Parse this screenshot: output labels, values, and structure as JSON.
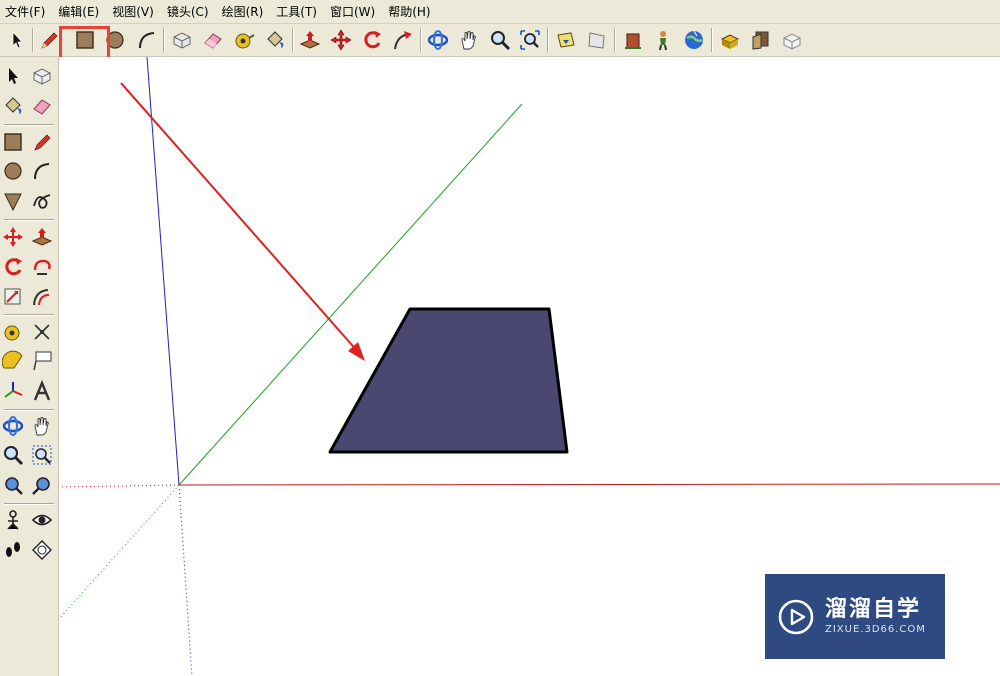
{
  "menu": {
    "items": [
      {
        "label": "文件(F)"
      },
      {
        "label": "编辑(E)"
      },
      {
        "label": "视图(V)"
      },
      {
        "label": "镜头(C)"
      },
      {
        "label": "绘图(R)"
      },
      {
        "label": "工具(T)"
      },
      {
        "label": "窗口(W)"
      },
      {
        "label": "帮助(H)"
      }
    ]
  },
  "toolbar": {
    "tools": [
      "select-arrow",
      "pencil-line",
      "rectangle",
      "circle",
      "arc",
      "make-component",
      "eraser",
      "tape-measure",
      "paint-bucket",
      "push-pull",
      "move",
      "rotate",
      "follow-me",
      "orbit",
      "pan-hand",
      "zoom",
      "zoom-extents",
      "previous-view",
      "next-view",
      "get-models",
      "share-model",
      "add-location",
      "google-earth",
      "get-photo-texture",
      "share-component",
      "send-to-layout"
    ],
    "highlighted_tool": "rectangle"
  },
  "left_toolbar": {
    "tools": [
      "select-arrow",
      "make-component",
      "paint-bucket",
      "eraser",
      "rectangle",
      "pencil-line",
      "circle",
      "arc",
      "polygon",
      "freehand",
      "move",
      "push-pull",
      "rotate",
      "follow-me",
      "scale",
      "offset",
      "tape-measure",
      "dimension",
      "protractor",
      "text-label",
      "axes",
      "3d-text",
      "orbit",
      "pan-hand",
      "zoom",
      "zoom-window",
      "zoom-extents",
      "previous-view",
      "position-camera",
      "look-around",
      "walk",
      "section-plane"
    ]
  },
  "viewport": {
    "background": "#ffffff",
    "axis_colors": {
      "red": "#c01818",
      "green": "#1aa01a",
      "blue": "#2020c0"
    },
    "face_color": "#4a4770",
    "arrow_color": "#e02020"
  },
  "watermark": {
    "title": "溜溜自学",
    "url": "ZIXUE.3D66.COM",
    "bg": "#2e4a80"
  },
  "highlight_color": "#e8413c"
}
